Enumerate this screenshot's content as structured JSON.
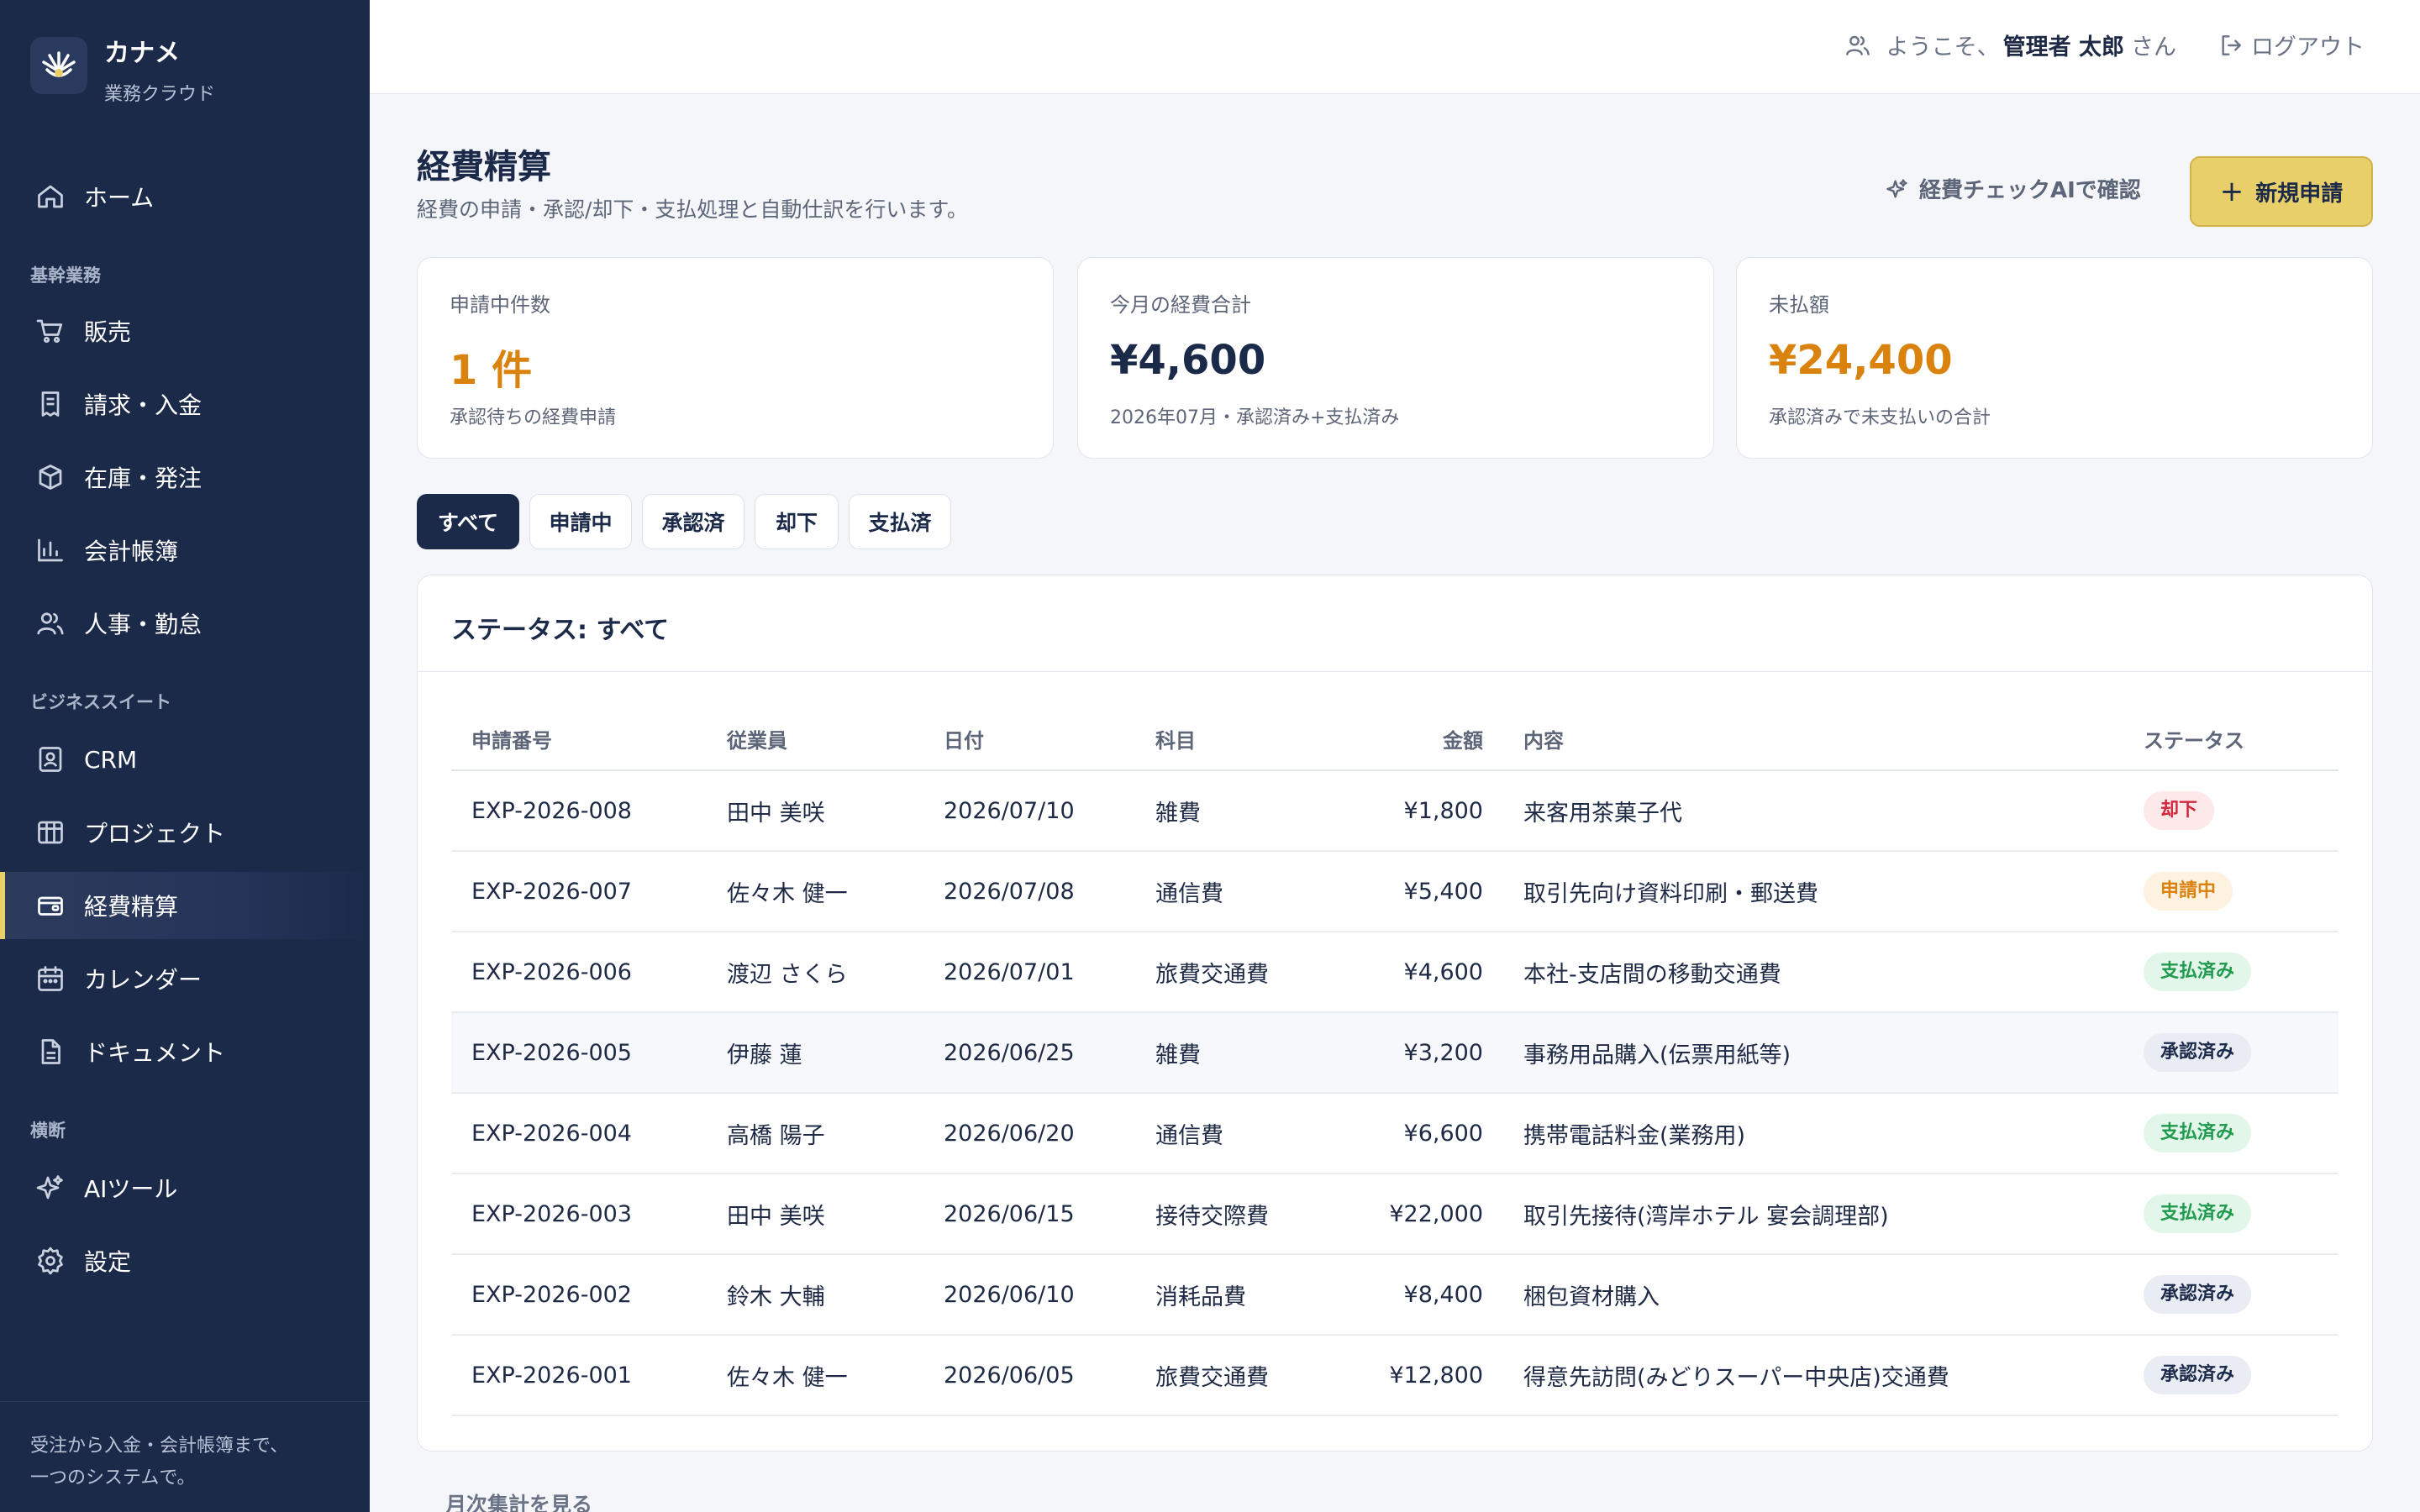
{
  "brand": {
    "name": "カナメ",
    "subtitle": "業務クラウド"
  },
  "nav": {
    "home": "ホーム",
    "section_core": "基幹業務",
    "sales": "販売",
    "billing": "請求・入金",
    "inventory": "在庫・発注",
    "ledger": "会計帳簿",
    "hr": "人事・勤怠",
    "section_suite": "ビジネススイート",
    "crm": "CRM",
    "project": "プロジェクト",
    "expense": "経費精算",
    "calendar": "カレンダー",
    "document": "ドキュメント",
    "section_cross": "横断",
    "ai_tools": "AIツール",
    "settings": "設定"
  },
  "sidebar_footer": {
    "line1": "受注から入金・会計帳簿まで、",
    "line2": "一つのシステムで。"
  },
  "topbar": {
    "welcome_prefix": "ようこそ、",
    "user_name": "管理者 太郎",
    "welcome_suffix": "さん",
    "logout": "ログアウト"
  },
  "page": {
    "title": "経費精算",
    "subtitle": "経費の申請・承認/却下・支払処理と自動仕訳を行います。",
    "ai_check": "経費チェックAIで確認",
    "new_request_plus": "+",
    "new_request": "新規申請"
  },
  "stats": [
    {
      "label": "申請中件数",
      "value": "1 件",
      "note": "承認待ちの経費申請"
    },
    {
      "label": "今月の経費合計",
      "value": "¥4,600",
      "note": "2026年07月・承認済み+支払済み"
    },
    {
      "label": "未払額",
      "value": "¥24,400",
      "note": "承認済みで未支払いの合計"
    }
  ],
  "filters": [
    "すべて",
    "申請中",
    "承認済",
    "却下",
    "支払済"
  ],
  "active_filter": "すべて",
  "table": {
    "title": "ステータス: すべて",
    "columns": [
      "申請番号",
      "従業員",
      "日付",
      "科目",
      "金額",
      "内容",
      "ステータス"
    ],
    "rows": [
      {
        "id": "EXP-2026-008",
        "employee": "田中 美咲",
        "date": "2026/07/10",
        "category": "雑費",
        "amount": "¥1,800",
        "description": "来客用茶菓子代",
        "status": "却下",
        "status_type": "rejected"
      },
      {
        "id": "EXP-2026-007",
        "employee": "佐々木 健一",
        "date": "2026/07/08",
        "category": "通信費",
        "amount": "¥5,400",
        "description": "取引先向け資料印刷・郵送費",
        "status": "申請中",
        "status_type": "pending"
      },
      {
        "id": "EXP-2026-006",
        "employee": "渡辺 さくら",
        "date": "2026/07/01",
        "category": "旅費交通費",
        "amount": "¥4,600",
        "description": "本社-支店間の移動交通費",
        "status": "支払済み",
        "status_type": "paid"
      },
      {
        "id": "EXP-2026-005",
        "employee": "伊藤 蓮",
        "date": "2026/06/25",
        "category": "雑費",
        "amount": "¥3,200",
        "description": "事務用品購入(伝票用紙等)",
        "status": "承認済み",
        "status_type": "approved"
      },
      {
        "id": "EXP-2026-004",
        "employee": "高橋 陽子",
        "date": "2026/06/20",
        "category": "通信費",
        "amount": "¥6,600",
        "description": "携帯電話料金(業務用)",
        "status": "支払済み",
        "status_type": "paid"
      },
      {
        "id": "EXP-2026-003",
        "employee": "田中 美咲",
        "date": "2026/06/15",
        "category": "接待交際費",
        "amount": "¥22,000",
        "description": "取引先接待(湾岸ホテル 宴会調理部)",
        "status": "支払済み",
        "status_type": "paid"
      },
      {
        "id": "EXP-2026-002",
        "employee": "鈴木 大輔",
        "date": "2026/06/10",
        "category": "消耗品費",
        "amount": "¥8,400",
        "description": "梱包資材購入",
        "status": "承認済み",
        "status_type": "approved"
      },
      {
        "id": "EXP-2026-001",
        "employee": "佐々木 健一",
        "date": "2026/06/05",
        "category": "旅費交通費",
        "amount": "¥12,800",
        "description": "得意先訪問(みどりスーパー中央店)交通費",
        "status": "承認済み",
        "status_type": "approved"
      }
    ]
  },
  "monthly_link": "月次集計を見る",
  "colors": {
    "sidebar": "#1c2a4a",
    "accent": "#e8cf6a",
    "orange": "#d9830e",
    "paid": "#1f9a4e",
    "rejected": "#d0283c"
  }
}
